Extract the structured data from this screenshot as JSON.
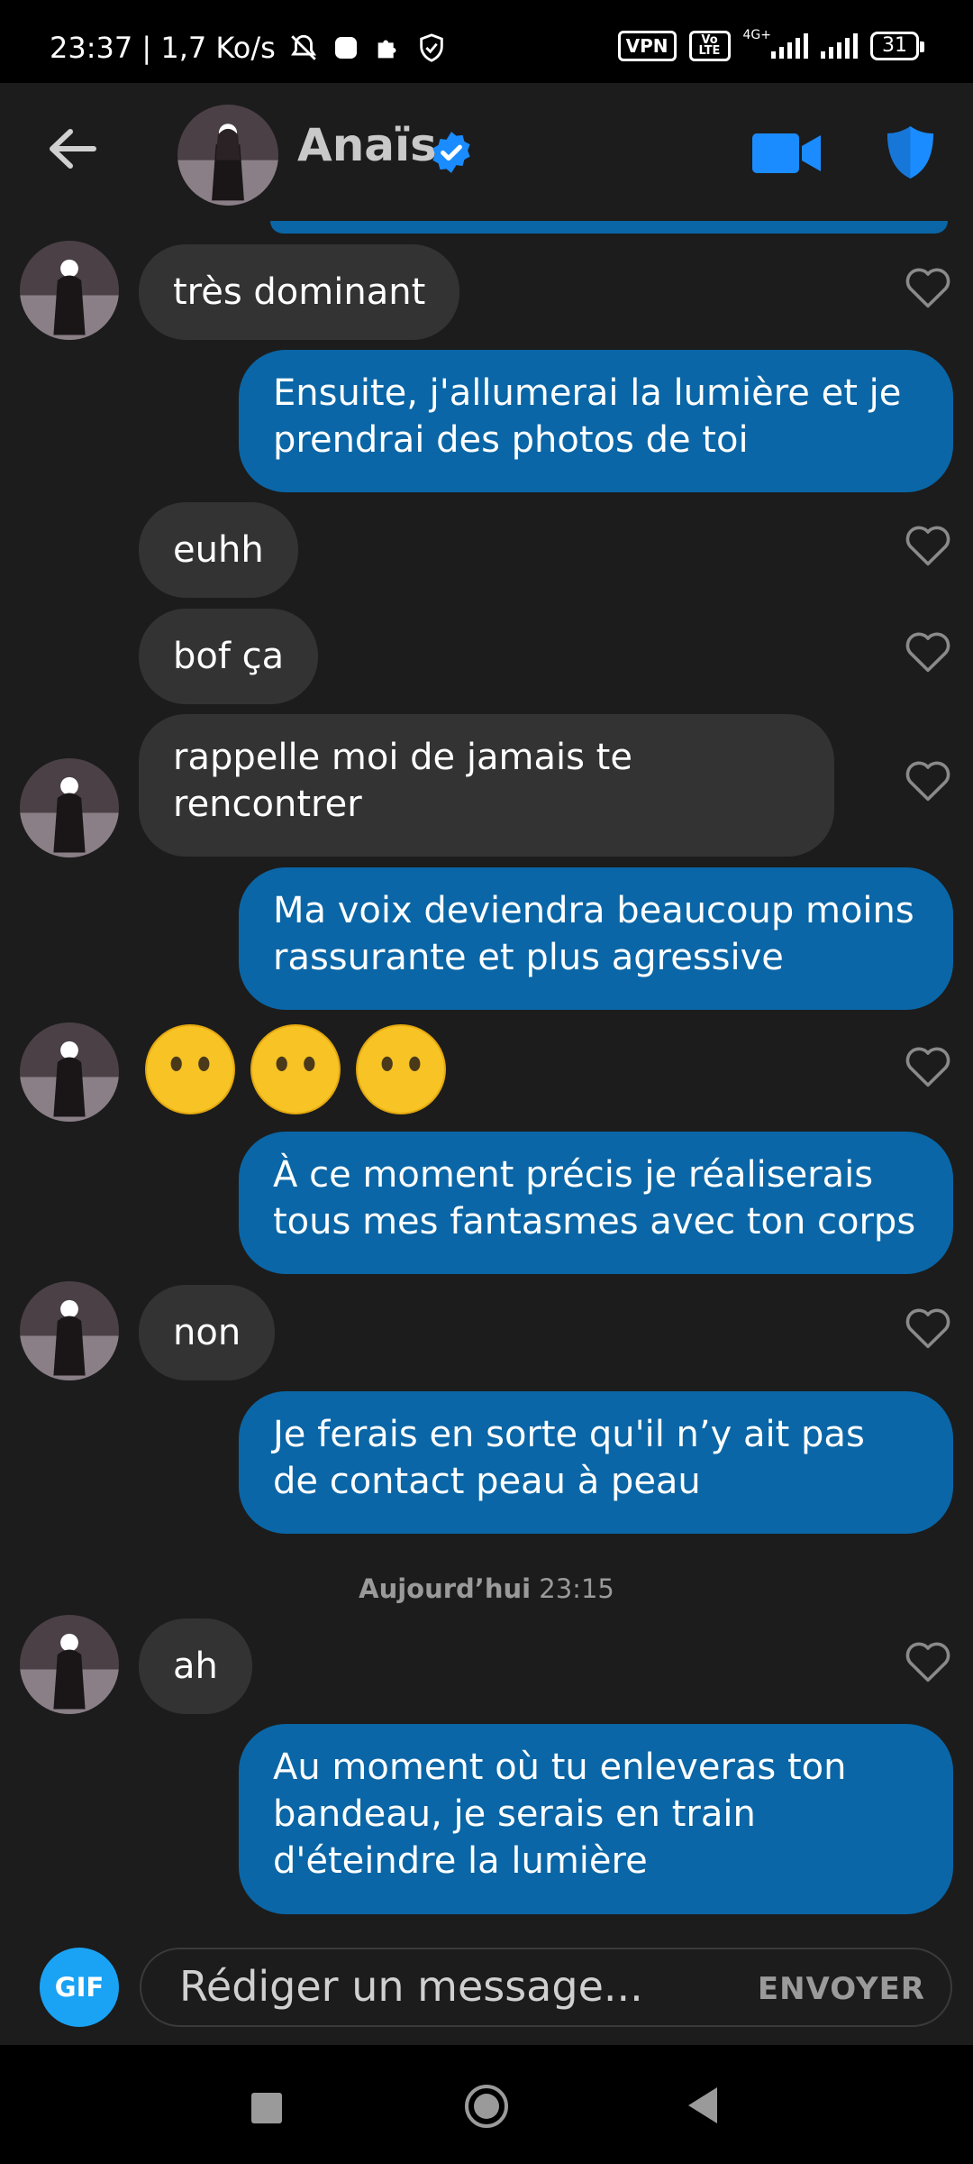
{
  "status_bar": {
    "time_speed": "23:37 | 1,7 Ko/s",
    "vpn": "VPN",
    "volte": "Vo LTE",
    "network": "4G+",
    "battery": "31"
  },
  "header": {
    "contact_name": "Anaïs",
    "icons": [
      "back-arrow-icon",
      "verified-badge-icon",
      "video-call-icon",
      "safety-shield-icon"
    ],
    "accent_color": "#1a8cff"
  },
  "messages": [
    {
      "side": "in",
      "text": "très dominant"
    },
    {
      "side": "out",
      "text": "Ensuite, j'allumerai la lumière et je prendrai des photos de toi"
    },
    {
      "side": "in",
      "text": "euhh"
    },
    {
      "side": "in",
      "text": "bof ça"
    },
    {
      "side": "in",
      "text": "rappelle moi de jamais te rencontrer"
    },
    {
      "side": "out",
      "text": "Ma voix deviendra beaucoup moins rassurante et plus agressive"
    },
    {
      "side": "in",
      "text": "😶😶😶"
    },
    {
      "side": "out",
      "text": "À ce moment précis je réaliserais tous mes fantasmes avec ton corps"
    },
    {
      "side": "in",
      "text": "non"
    },
    {
      "side": "out",
      "text": "Je ferais en sorte qu'il n’y ait pas de contact peau à peau"
    },
    {
      "side": "in",
      "text": "ah"
    },
    {
      "side": "out",
      "text": "Au moment où tu enleveras ton bandeau, je serais en train d'éteindre la lumière"
    }
  ],
  "timestamp": {
    "day": "Aujourd’hui",
    "time": "23:15"
  },
  "composer": {
    "gif_label": "GIF",
    "placeholder": "Rédiger un message...",
    "send_label": "ENVOYER"
  },
  "colors": {
    "background": "#1c1c1c",
    "incoming_bubble": "#333333",
    "outgoing_bubble": "#0a66a6",
    "gif_button": "#1aa3f5"
  }
}
